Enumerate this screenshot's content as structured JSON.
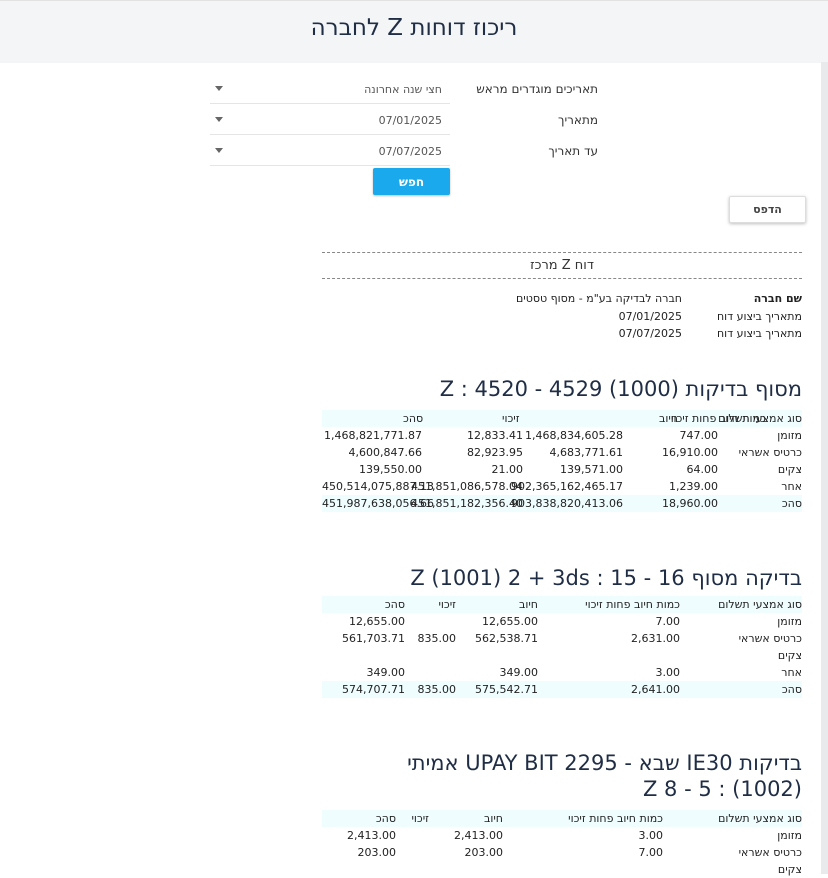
{
  "page": {
    "title": "ריכוז דוחות Z לחברה"
  },
  "filters": {
    "preset_label": "תאריכים מוגדרים מראש",
    "preset_value": "חצי שנה אחרונה",
    "from_label": "מתאריך",
    "from_value": "07/01/2025",
    "to_label": "עד תאריך",
    "to_value": "07/07/2025",
    "search_label": "חפש"
  },
  "print_label": "הדפס",
  "report": {
    "title": "דוח Z מרכז",
    "company_key": "שם חברה",
    "company_value": "חברה לבדיקה בע\"מ - מסוף טסטים",
    "from_key": "מתאריך ביצוע דוח",
    "from_value": "07/01/2025",
    "to_key": "מתאריך ביצוע דוח",
    "to_value": "07/07/2025"
  },
  "sections": [
    {
      "title": "מסוף בדיקות (1000) 4529 - 4520 : Z",
      "headers": [
        "סוג אמצעי תשלום",
        "כמות חיוב פחות זיכוי",
        "חיוב",
        "זיכוי",
        "סהכ"
      ],
      "rows": [
        [
          "מזומן",
          "747.00",
          "1,468,834,605.28",
          "12,833.41",
          "1,468,821,771.87"
        ],
        [
          "כרטיס אשראי",
          "16,910.00",
          "4,683,771.61",
          "82,923.95",
          "4,600,847.66"
        ],
        [
          "צקים",
          "64.00",
          "139,571.00",
          "21.00",
          "139,550.00"
        ],
        [
          "אחר",
          "1,239.00",
          "902,365,162,465.17",
          "451,851,086,578.04",
          "450,514,075,887.13"
        ],
        [
          "סהכ",
          "18,960.00",
          "903,838,820,413.06",
          "451,851,182,356.40",
          "451,987,638,056.66"
        ]
      ]
    },
    {
      "title": "בדיקה מסוף 16 - 15 : Z (1001) 2 + 3ds",
      "headers": [
        "סוג אמצעי תשלום",
        "כמות חיוב פחות זיכוי",
        "חיוב",
        "זיכוי",
        "סהכ"
      ],
      "rows": [
        [
          "מזומן",
          "7.00",
          "12,655.00",
          "",
          "12,655.00"
        ],
        [
          "כרטיס אשראי",
          "2,631.00",
          "562,538.71",
          "835.00",
          "561,703.71"
        ],
        [
          "צקים",
          "",
          "",
          "",
          ""
        ],
        [
          "אחר",
          "3.00",
          "349.00",
          "",
          "349.00"
        ],
        [
          "סהכ",
          "2,641.00",
          "575,542.71",
          "835.00",
          "574,707.71"
        ]
      ]
    },
    {
      "title": "בדיקות IE30 שבא - UPAY BIT 2295 אמיתי (1002) : Z 8 - 5",
      "headers": [
        "סוג אמצעי תשלום",
        "כמות חיוב פחות זיכוי",
        "חיוב",
        "זיכוי",
        "סהכ"
      ],
      "rows": [
        [
          "מזומן",
          "3.00",
          "2,413.00",
          "",
          "2,413.00"
        ],
        [
          "כרטיס אשראי",
          "7.00",
          "203.00",
          "",
          "203.00"
        ],
        [
          "צקים",
          "",
          "",
          "",
          ""
        ]
      ]
    }
  ]
}
